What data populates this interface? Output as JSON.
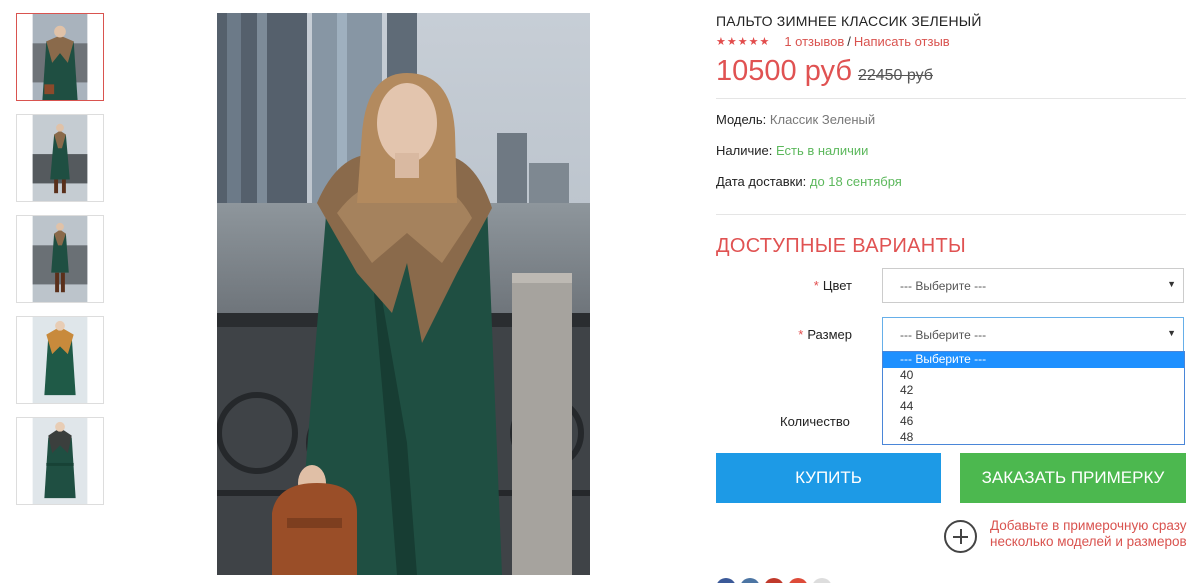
{
  "product": {
    "title": "ПАЛЬТО ЗИМНЕЕ КЛАССИК ЗЕЛЕНЫЙ",
    "stars": "★★★★★",
    "rating": 5,
    "reviews_link": "1 отзывов",
    "write_review_link": "Написать отзыв",
    "separator": "/",
    "price": "10500 руб",
    "old_price": "22450 руб"
  },
  "specs": [
    {
      "label": "Модель:",
      "value": "Классик Зеленый"
    },
    {
      "label": "Наличие:",
      "value": "Есть в наличии"
    },
    {
      "label": "Дата доставки:",
      "value": "до 18 сентября"
    }
  ],
  "options": {
    "heading": "ДОСТУПНЫЕ ВАРИАНТЫ",
    "required_mark": "*",
    "color_label": "Цвет",
    "color_value": "--- Выберите ---",
    "size_label": "Размер",
    "size_value": "--- Выберите ---",
    "size_options": [
      "--- Выберите ---",
      "40",
      "42",
      "44",
      "46",
      "48"
    ],
    "quantity_label": "Количество",
    "caret": "▼"
  },
  "buttons": {
    "buy": "КУПИТЬ",
    "fitting": "ЗАКАЗАТЬ ПРИМЕРКУ"
  },
  "add_to_fitting": "Добавьте в примерочную сразу несколько моделей и размеров",
  "colors": {
    "accent_red": "#e05252",
    "buy_blue": "#1d9ae6",
    "fit_green": "#4cb84f",
    "coat_green": "#1f4f42",
    "in_stock_green": "#5cb85c"
  },
  "thumbnails": [
    {
      "selected": true
    },
    {
      "selected": false
    },
    {
      "selected": false
    },
    {
      "selected": false
    },
    {
      "selected": false
    }
  ]
}
